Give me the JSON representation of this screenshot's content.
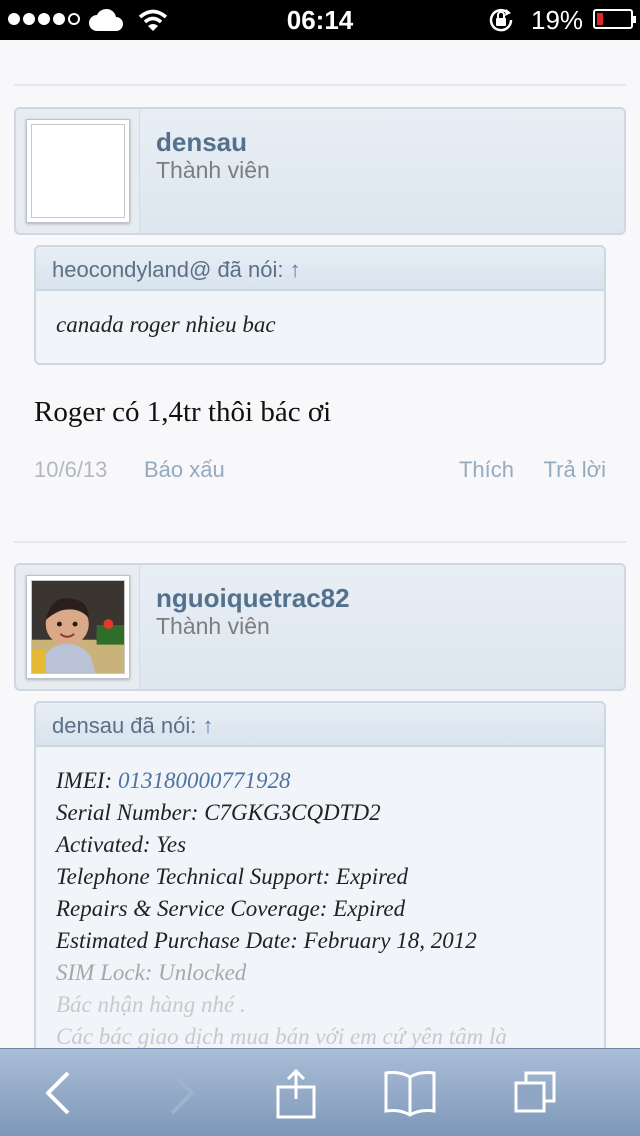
{
  "status_bar": {
    "time": "06:14",
    "battery": "19%",
    "battery_level": 0.19
  },
  "posts": [
    {
      "user": {
        "name": "densau",
        "role": "Thành viên"
      },
      "quote": {
        "author": "heocondyland@ đã nói:",
        "arrow": "↑",
        "text": "canada roger nhieu bac"
      },
      "message": "Roger có 1,4tr thôi bác ơi",
      "meta": {
        "date": "10/6/13",
        "report": "Báo xấu",
        "like": "Thích",
        "reply": "Trả lời"
      }
    },
    {
      "user": {
        "name": "nguoiquetrac82",
        "role": "Thành viên"
      },
      "quote": {
        "author": "densau đã nói:",
        "arrow": "↑",
        "imei_label": "IMEI:",
        "imei_value": "013180000771928",
        "lines": [
          "Serial Number: C7GKG3CQDTD2",
          "Activated: Yes",
          "Telephone Technical Support: Expired",
          "Repairs & Service Coverage: Expired",
          "Estimated Purchase Date: February 18, 2012"
        ],
        "faded_line": "SIM Lock: Unlocked",
        "faded_line2": "Bác nhận hàng nhé .",
        "faded_line3": "Các bác giao dịch mua bán với em cứ yên tâm là"
      }
    }
  ],
  "toolbar": {
    "icons": [
      "back-icon",
      "forward-icon",
      "share-icon",
      "bookmarks-icon",
      "tabs-icon"
    ]
  }
}
